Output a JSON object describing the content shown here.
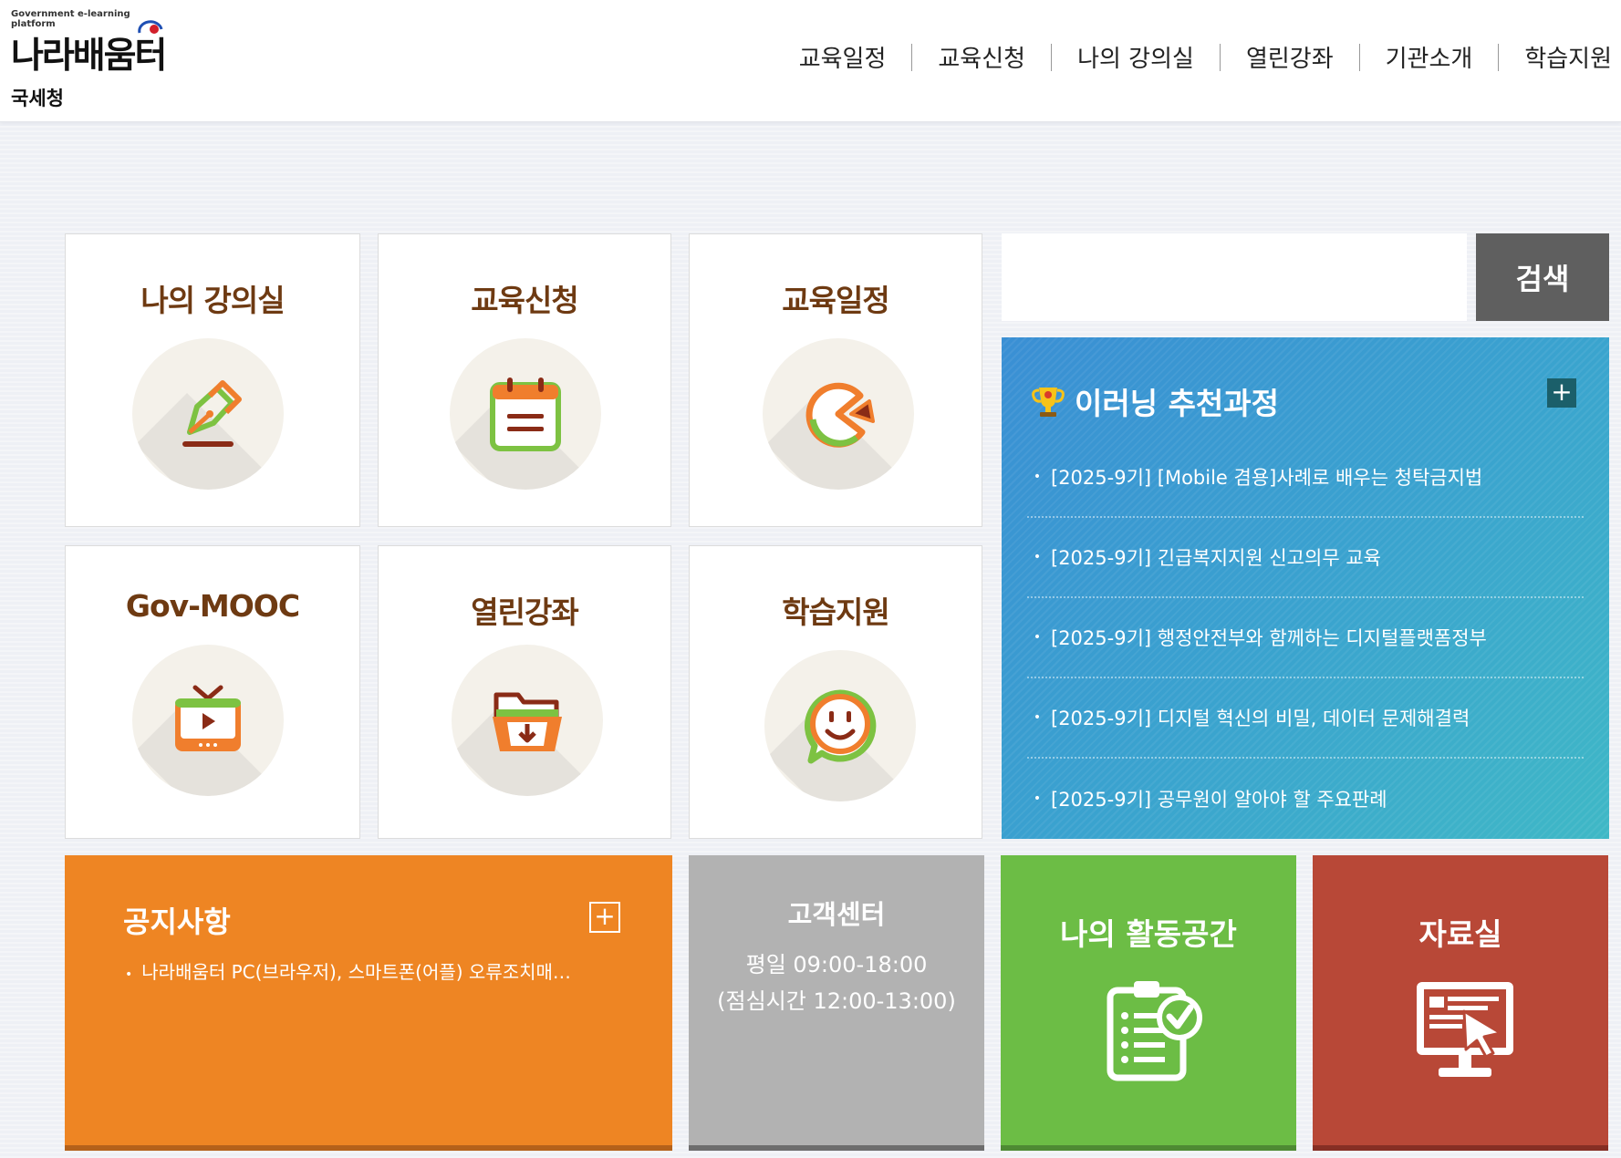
{
  "header": {
    "logo_sub": "Government e-learning platform",
    "logo_main": "나라배움터",
    "agency": "국세청",
    "nav": [
      "교육일정",
      "교육신청",
      "나의 강의실",
      "열린강좌",
      "기관소개",
      "학습지원"
    ]
  },
  "tiles": [
    {
      "title": "나의 강의실",
      "icon": "pen-icon"
    },
    {
      "title": "교육신청",
      "icon": "calendar-icon"
    },
    {
      "title": "교육일정",
      "icon": "pie-chart-icon"
    },
    {
      "title": "Gov-MOOC",
      "icon": "tv-play-icon"
    },
    {
      "title": "열린강좌",
      "icon": "folder-download-icon"
    },
    {
      "title": "학습지원",
      "icon": "smiley-chat-icon"
    }
  ],
  "search": {
    "placeholder": "",
    "button_label": "검색"
  },
  "recommend": {
    "title": "이러닝 추천과정",
    "icon": "trophy-icon",
    "items": [
      "[2025-9기] [Mobile 겸용]사례로 배우는 청탁금지법",
      "[2025-9기] 긴급복지지원 신고의무 교육",
      "[2025-9기] 행정안전부와 함께하는 디지털플랫폼정부",
      "[2025-9기] 디지털 혁신의 비밀, 데이터 문제해결력",
      "[2025-9기] 공무원이 알아야 할 주요판례"
    ]
  },
  "notice": {
    "title": "공지사항",
    "items": [
      "나라배움터 PC(브라우저), 스마트폰(어플) 오류조치매…"
    ]
  },
  "customer_center": {
    "title": "고객센터",
    "hours": "평일 09:00-18:00",
    "lunch": "(점심시간 12:00-13:00)"
  },
  "activity": {
    "title": "나의 활동공간",
    "icon": "clipboard-check-icon"
  },
  "archive": {
    "title": "자료실",
    "icon": "monitor-cursor-icon"
  },
  "colors": {
    "notice": "#ee8523",
    "customer_center": "#b2b2b2",
    "activity": "#6cbd45",
    "archive": "#b84837",
    "recommend": "#3aa2cf",
    "tile_title": "#6e3a12"
  }
}
